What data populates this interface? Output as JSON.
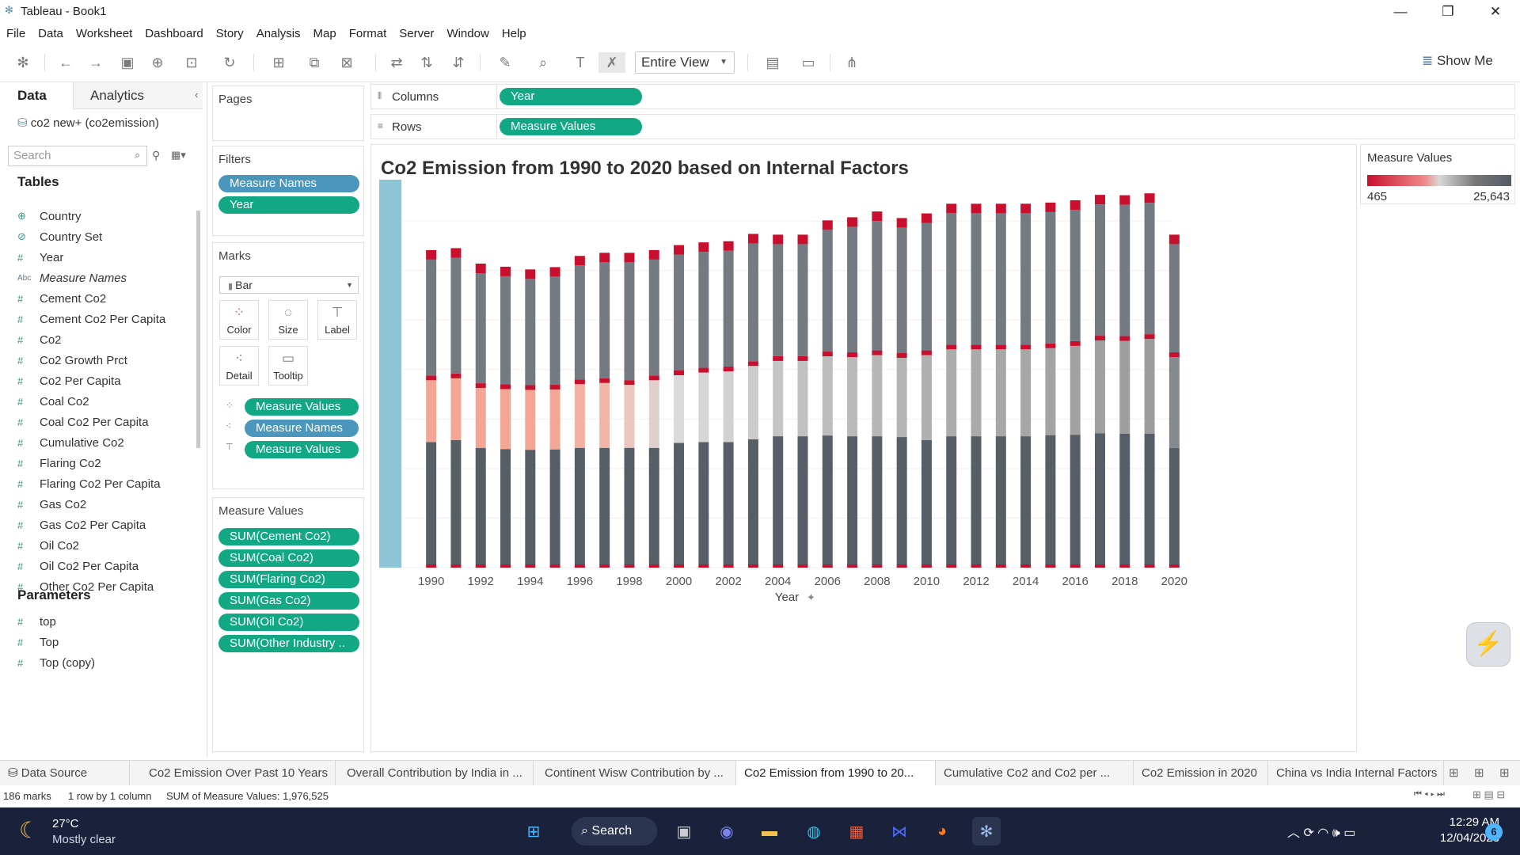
{
  "window": {
    "title": "Tableau - Book1",
    "min": "—",
    "max": "❐",
    "close": "✕"
  },
  "menu": [
    "File",
    "Data",
    "Worksheet",
    "Dashboard",
    "Story",
    "Analysis",
    "Map",
    "Format",
    "Server",
    "Window",
    "Help"
  ],
  "toolbar": {
    "fit_mode": "Entire View",
    "show_me": "Show Me"
  },
  "data_pane": {
    "tab_data": "Data",
    "tab_analytics": "Analytics",
    "datasource": "co2 new+ (co2emission)",
    "search_placeholder": "Search",
    "tables_header": "Tables",
    "fields": [
      {
        "name": "Country",
        "type": "geo"
      },
      {
        "name": "Country Set",
        "type": "set"
      },
      {
        "name": "Year",
        "type": "measure"
      },
      {
        "name": "Measure Names",
        "type": "abc"
      },
      {
        "name": "Cement Co2",
        "type": "measure"
      },
      {
        "name": "Cement Co2 Per Capita",
        "type": "measure"
      },
      {
        "name": "Co2",
        "type": "measure"
      },
      {
        "name": "Co2 Growth Prct",
        "type": "measure"
      },
      {
        "name": "Co2 Per Capita",
        "type": "measure"
      },
      {
        "name": "Coal Co2",
        "type": "measure"
      },
      {
        "name": "Coal Co2 Per Capita",
        "type": "measure"
      },
      {
        "name": "Cumulative Co2",
        "type": "measure"
      },
      {
        "name": "Flaring Co2",
        "type": "measure"
      },
      {
        "name": "Flaring Co2 Per Capita",
        "type": "measure"
      },
      {
        "name": "Gas Co2",
        "type": "measure"
      },
      {
        "name": "Gas Co2 Per Capita",
        "type": "measure"
      },
      {
        "name": "Oil Co2",
        "type": "measure"
      },
      {
        "name": "Oil Co2 Per Capita",
        "type": "measure"
      },
      {
        "name": "Other Co2 Per Capita",
        "type": "measure"
      }
    ],
    "parameters_header": "Parameters",
    "parameters": [
      "top",
      "Top",
      "Top (copy)"
    ]
  },
  "cards": {
    "pages": "Pages",
    "filters": "Filters",
    "filter_pills": [
      "Measure Names",
      "Year"
    ],
    "marks": "Marks",
    "mark_type": "Bar",
    "mark_buttons": [
      "Color",
      "Size",
      "Label",
      "Detail",
      "Tooltip"
    ],
    "mark_pills": [
      "Measure Values",
      "Measure Names",
      "Measure Values"
    ],
    "measure_values": "Measure Values",
    "mv_pills": [
      "SUM(Cement Co2)",
      "SUM(Coal Co2)",
      "SUM(Flaring Co2)",
      "SUM(Gas Co2)",
      "SUM(Oil Co2)",
      "SUM(Other Industry .."
    ]
  },
  "shelves": {
    "columns_label": "Columns",
    "columns_pill": "Year",
    "rows_label": "Rows",
    "rows_pill": "Measure Values"
  },
  "legend": {
    "title": "Measure Values",
    "min": "465",
    "max": "25,643"
  },
  "chart_data": {
    "type": "bar",
    "title": "Co2 Emission from 1990 to 2020 based on Internal Factors",
    "xlabel": "Year",
    "tick_labels": [
      "1990",
      "1992",
      "1994",
      "1996",
      "1998",
      "2000",
      "2002",
      "2004",
      "2006",
      "2008",
      "2010",
      "2012",
      "2014",
      "2016",
      "2018",
      "2020"
    ],
    "years": [
      1990,
      1991,
      1992,
      1993,
      1994,
      1995,
      1996,
      1997,
      1998,
      1999,
      2000,
      2001,
      2002,
      2003,
      2004,
      2005,
      2006,
      2007,
      2008,
      2009,
      2010,
      2011,
      2012,
      2013,
      2014,
      2015,
      2016,
      2017,
      2018,
      2019,
      2020
    ],
    "stack_fractions": {
      "bottom": [
        0.325,
        0.33,
        0.31,
        0.307,
        0.305,
        0.306,
        0.31,
        0.31,
        0.31,
        0.31,
        0.323,
        0.325,
        0.325,
        0.332,
        0.34,
        0.34,
        0.342,
        0.34,
        0.34,
        0.338,
        0.33,
        0.34,
        0.34,
        0.34,
        0.34,
        0.343,
        0.344,
        0.348,
        0.347,
        0.347,
        0.31
      ],
      "middle": [
        0.16,
        0.16,
        0.155,
        0.155,
        0.155,
        0.155,
        0.165,
        0.168,
        0.163,
        0.175,
        0.175,
        0.18,
        0.183,
        0.19,
        0.195,
        0.195,
        0.205,
        0.205,
        0.21,
        0.205,
        0.22,
        0.225,
        0.225,
        0.225,
        0.225,
        0.225,
        0.23,
        0.24,
        0.24,
        0.245,
        0.235
      ],
      "top": [
        0.3,
        0.3,
        0.285,
        0.28,
        0.275,
        0.28,
        0.295,
        0.3,
        0.305,
        0.3,
        0.3,
        0.3,
        0.3,
        0.305,
        0.29,
        0.29,
        0.315,
        0.325,
        0.335,
        0.325,
        0.33,
        0.34,
        0.34,
        0.34,
        0.34,
        0.34,
        0.34,
        0.34,
        0.34,
        0.34,
        0.28
      ]
    },
    "middle_colors": [
      "#f4a694",
      "#f4a694",
      "#f4a694",
      "#f4a694",
      "#f4a694",
      "#f4a694",
      "#f3b1a4",
      "#f3b5a8",
      "#ebc6bf",
      "#e0d0cd",
      "#dadada",
      "#d6d6d6",
      "#d1d1d1",
      "#cbcbcb",
      "#c5c5c5",
      "#c1c1c1",
      "#bdbdbd",
      "#bababa",
      "#b7b7b7",
      "#b4b4b4",
      "#b0b0b0",
      "#acacac",
      "#aaaaaa",
      "#a8a8a8",
      "#a6a6a6",
      "#a4a4a4",
      "#a2a2a2",
      "#a0a0a0",
      "#9e9e9e",
      "#9c9c9c",
      "#858a90"
    ],
    "colors": {
      "bottom": "#565e68",
      "top": "#737a82",
      "accent": "#c8102e",
      "band": "#8dc4d6"
    }
  },
  "sheets": [
    "Data Source",
    "Co2 Emission Over Past 10 Years",
    "Overall Contribution by India in ...",
    "Continent Wisw Contribution by ...",
    "Co2 Emission from 1990 to 20...",
    "Cumulative Co2 and Co2 per ...",
    "Co2 Emission in 2020",
    "China vs India Internal Factors"
  ],
  "status": {
    "marks": "186 marks",
    "rows": "1 row by 1 column",
    "sum": "SUM of Measure Values: 1,976,525"
  },
  "taskbar": {
    "temp": "27°C",
    "weather": "Mostly clear",
    "search": "Search",
    "time": "12:29 AM",
    "date": "12/04/2023",
    "badge": "6"
  }
}
